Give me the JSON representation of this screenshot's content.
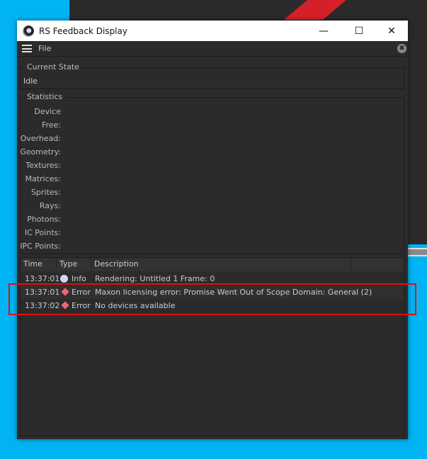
{
  "window": {
    "title": "RS Feedback Display",
    "minimize": "—",
    "maximize": "☐",
    "close": "✕"
  },
  "menu": {
    "file": "File",
    "close_icon": "✖"
  },
  "current_state": {
    "label": "Current State",
    "value": "Idle"
  },
  "statistics": {
    "label": "Statistics",
    "items": [
      "Device",
      "Free:",
      "Overhead:",
      "Geometry:",
      "Textures:",
      "Matrices:",
      "Sprites:",
      "Rays:",
      "Photons:",
      "IC Points:",
      "IPC Points:"
    ]
  },
  "log": {
    "columns": [
      "Time",
      "Type",
      "Description"
    ],
    "rows": [
      {
        "time": "13:37:01",
        "type": "Info",
        "icon": "info-dot",
        "description": "Rendering: Untitled 1 Frame: 0"
      },
      {
        "time": "13:37:01",
        "type": "Error",
        "icon": "error-diamond",
        "description": "Maxon licensing error: Promise Went Out of Scope Domain: General (2)"
      },
      {
        "time": "13:37:02",
        "type": "Error",
        "icon": "error-diamond",
        "description": "No devices available"
      }
    ]
  },
  "colors": {
    "highlight": "#e01010",
    "error": "#f06570",
    "info": "#cfd6f7"
  }
}
